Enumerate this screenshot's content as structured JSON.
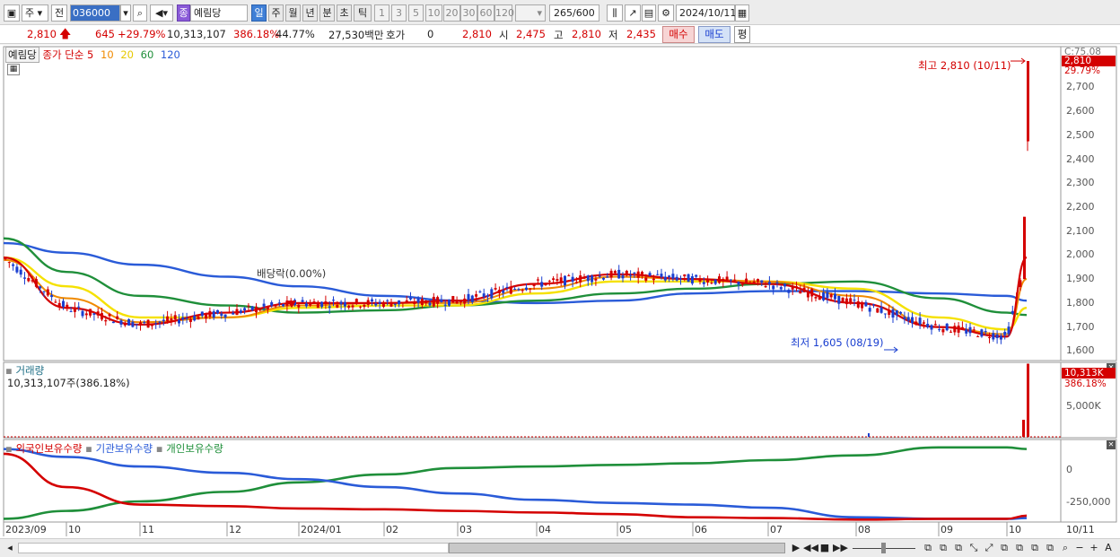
{
  "toolbar": {
    "market": "주",
    "prev": "전",
    "code": "036000",
    "stock_badge": "종",
    "stock_name": "예림당",
    "periods": [
      "일",
      "주",
      "월",
      "년",
      "분",
      "초",
      "틱"
    ],
    "active_period": "일",
    "intervals": [
      "1",
      "3",
      "5",
      "10",
      "20",
      "30",
      "60",
      "120"
    ],
    "count": "265",
    "count_total": "/600",
    "date": "2024/10/11"
  },
  "quote": {
    "price": "2,810",
    "change": "645",
    "change_pct": "+29.79%",
    "volume": "10,313,107",
    "volume_pct": "386.18%",
    "turnover": "44.77%",
    "amount": "27,530백만",
    "hoga_label": "호가",
    "hoga_value": "0",
    "close_value": "2,810",
    "open_label": "시",
    "open_value": "2,475",
    "high_label": "고",
    "high_value": "2,810",
    "low_label": "저",
    "low_value": "2,435",
    "buy_label": "매수",
    "sell_label": "매도",
    "avg_label": "평"
  },
  "price_pane": {
    "title": "예림당",
    "ma_label": "종가 단순",
    "ma_periods": [
      "5",
      "10",
      "20",
      "60",
      "120"
    ],
    "top_right": "C:75.08",
    "last_price_tag": "2,810",
    "last_pct_tag": "29.79%",
    "high_annotation": "최고 2,810 (10/11)",
    "low_annotation": "최저 1,605 (08/19)",
    "dividend_annotation": "배당락(0.00%)"
  },
  "volume_pane": {
    "title": "거래량",
    "value": "10,313,107주(386.18%)",
    "last_tag": "10,313K",
    "last_pct_tag": "386.18%",
    "ytick": "5,000K"
  },
  "holdings_pane": {
    "series": [
      "외국인보유수량",
      "기관보유수량",
      "개인보유수량"
    ],
    "yticks": [
      "0",
      "-250,000"
    ]
  },
  "x_labels": [
    "2023/09",
    "10",
    "11",
    "12",
    "2024/01",
    "02",
    "03",
    "04",
    "05",
    "06",
    "07",
    "08",
    "09",
    "10",
    "10/11"
  ],
  "colors": {
    "ma5": "#d40000",
    "ma10": "#f08a00",
    "ma20": "#f5e100",
    "ma60": "#1f8f3a",
    "ma120": "#2a5bd8",
    "up": "#d40000",
    "down": "#1a3fd0"
  },
  "chart_data": [
    {
      "type": "line",
      "title": "예림당 종가 단순 5 10 20 60 120",
      "x": [
        "2023/09",
        "10",
        "11",
        "12",
        "2024/01",
        "02",
        "03",
        "04",
        "05",
        "06",
        "07",
        "08",
        "09",
        "10",
        "10/11"
      ],
      "series": [
        {
          "name": "5",
          "values": [
            1990,
            1780,
            1710,
            1760,
            1800,
            1800,
            1810,
            1880,
            1920,
            1900,
            1880,
            1800,
            1700,
            1660,
            1990
          ]
        },
        {
          "name": "10",
          "values": [
            1980,
            1820,
            1720,
            1740,
            1790,
            1800,
            1800,
            1860,
            1910,
            1900,
            1890,
            1830,
            1700,
            1670,
            1900
          ]
        },
        {
          "name": "20",
          "values": [
            1990,
            1870,
            1740,
            1740,
            1780,
            1790,
            1790,
            1840,
            1890,
            1890,
            1890,
            1860,
            1740,
            1690,
            1780
          ]
        },
        {
          "name": "60",
          "values": [
            2070,
            1930,
            1830,
            1790,
            1760,
            1770,
            1790,
            1810,
            1840,
            1860,
            1880,
            1890,
            1820,
            1760,
            1750
          ]
        },
        {
          "name": "120",
          "values": [
            2050,
            2010,
            1960,
            1910,
            1870,
            1830,
            1810,
            1800,
            1810,
            1840,
            1850,
            1850,
            1840,
            1830,
            1810
          ]
        }
      ],
      "ylim": [
        1560,
        2870
      ],
      "yticks": [
        1600,
        1700,
        1800,
        1900,
        2000,
        2100,
        2200,
        2300,
        2400,
        2500,
        2600,
        2700
      ],
      "ohlc_last": {
        "open": 2475,
        "high": 2810,
        "low": 2435,
        "close": 2810
      },
      "grid": true
    },
    {
      "type": "bar",
      "title": "거래량",
      "x": [
        "2023/09",
        "10",
        "11",
        "12",
        "2024/01",
        "02",
        "03",
        "04",
        "05",
        "06",
        "07",
        "08",
        "09",
        "10",
        "10/11"
      ],
      "values": [
        0,
        0,
        0,
        0,
        0,
        0,
        0,
        0,
        0,
        0,
        0,
        0,
        0,
        0,
        10313107
      ],
      "ylim": [
        0,
        10500000
      ],
      "yticks": [
        5000000
      ]
    },
    {
      "type": "line",
      "title": "보유수량",
      "x": [
        "2023/09",
        "10",
        "11",
        "12",
        "2024/01",
        "02",
        "03",
        "04",
        "05",
        "06",
        "07",
        "08",
        "09",
        "10",
        "10/11"
      ],
      "series": [
        {
          "name": "외국인보유수량",
          "values": [
            60000,
            -150000,
            -260000,
            -270000,
            -285000,
            -290000,
            -300000,
            -310000,
            -320000,
            -340000,
            -345000,
            -355000,
            -350000,
            -350000,
            -330000
          ]
        },
        {
          "name": "기관보유수량",
          "values": [
            90000,
            40000,
            -20000,
            -60000,
            -100000,
            -150000,
            -190000,
            -230000,
            -250000,
            -260000,
            -280000,
            -340000,
            -350000,
            -350000,
            -345000
          ]
        },
        {
          "name": "개인보유수량",
          "values": [
            -350000,
            -300000,
            -240000,
            -180000,
            -120000,
            -70000,
            -30000,
            -20000,
            -10000,
            0,
            20000,
            50000,
            100000,
            100000,
            90000
          ]
        }
      ],
      "ylim": [
        -370000,
        150000
      ],
      "yticks": [
        0,
        -250000
      ]
    }
  ]
}
